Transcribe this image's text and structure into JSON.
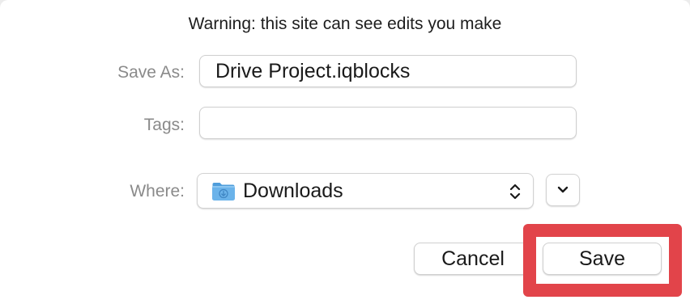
{
  "dialog": {
    "title": "Warning: this site can see edits you make",
    "save_as": {
      "label": "Save As:",
      "value": "Drive Project.iqblocks"
    },
    "tags": {
      "label": "Tags:",
      "value": "",
      "placeholder": ""
    },
    "where": {
      "label": "Where:",
      "value": "Downloads",
      "icon": "folder-downloads-icon"
    },
    "buttons": {
      "cancel": "Cancel",
      "save": "Save"
    }
  },
  "colors": {
    "highlight": "#e2444a",
    "folder_blue": "#6bb3ea"
  }
}
